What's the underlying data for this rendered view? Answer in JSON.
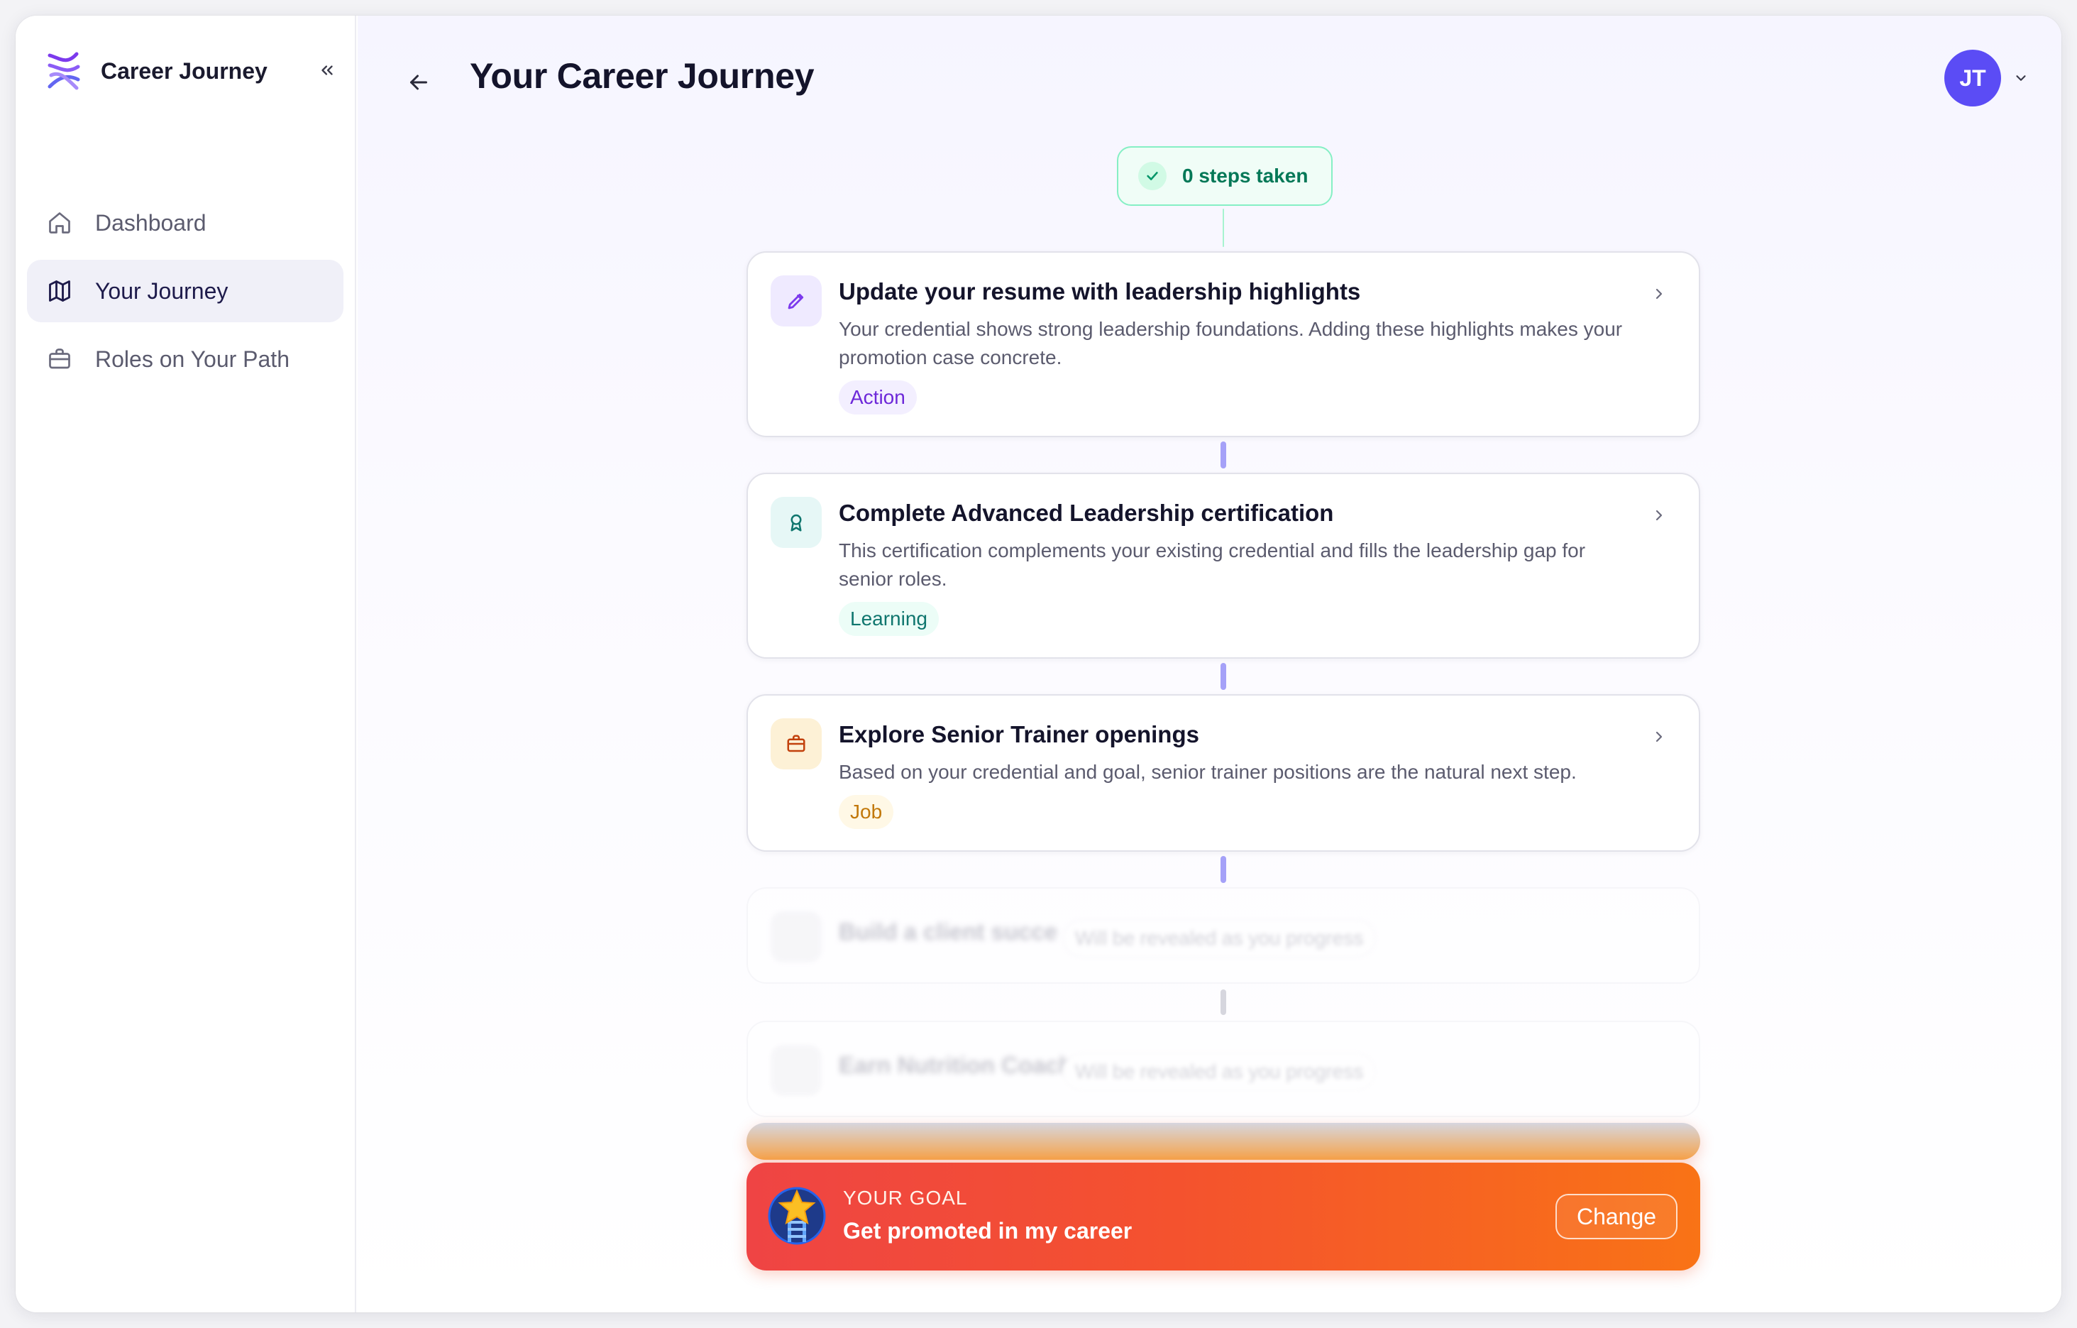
{
  "sidebar": {
    "brand": "Career Journey",
    "items": [
      {
        "label": "Dashboard",
        "icon": "home-icon",
        "active": false
      },
      {
        "label": "Your Journey",
        "icon": "map-icon",
        "active": true
      },
      {
        "label": "Roles on Your Path",
        "icon": "briefcase-icon",
        "active": false
      }
    ]
  },
  "header": {
    "title": "Your Career Journey",
    "avatar_initials": "JT"
  },
  "journey": {
    "steps_taken": "0 steps taken",
    "steps": [
      {
        "title": "Update your resume with leadership highlights",
        "description": "Your credential shows strong leadership foundations. Adding these highlights makes your promotion case concrete.",
        "tag": "Action",
        "icon": "pencil-icon"
      },
      {
        "title": "Complete Advanced Leadership certification",
        "description": "This certification complements your existing credential and fills the leadership gap for senior roles.",
        "tag": "Learning",
        "icon": "award-icon"
      },
      {
        "title": "Explore Senior Trainer openings",
        "description": "Based on your credential and goal, senior trainer positions are the natural next step.",
        "tag": "Job",
        "icon": "briefcase-icon"
      }
    ],
    "locked": [
      {
        "title": "Build a client succe",
        "hint": "Will be revealed as you progress"
      },
      {
        "title": "Earn Nutrition Coach",
        "hint": "Will be revealed as you progress"
      }
    ]
  },
  "goal": {
    "label": "YOUR GOAL",
    "value": "Get promoted in my career",
    "button": "Change"
  },
  "colors": {
    "accent": "#5b4cf5",
    "success": "#047857",
    "goal_start": "#ef4444",
    "goal_end": "#f97316"
  }
}
